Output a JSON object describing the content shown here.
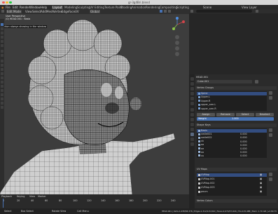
{
  "window": {
    "title": "gr-3g4Bri.blend"
  },
  "top_menu": {
    "items": [
      "File",
      "Edit",
      "Render",
      "Window",
      "Help"
    ],
    "workspaces": [
      "Layout",
      "Modeling",
      "Sculpting",
      "UV Editing",
      "Texture Paint",
      "Shading",
      "Animation",
      "Rendering",
      "Compositing",
      "Scripting"
    ],
    "active_workspace": "Layout",
    "scene": "Scene",
    "view_layer": "View Layer"
  },
  "viewport": {
    "mode": "Edit Mode",
    "menus": [
      "View",
      "Select",
      "Add",
      "Mesh",
      "Vertex",
      "Edge",
      "Face",
      "UV"
    ],
    "transform": "Global",
    "overlay_title": "User Perspective",
    "overlay_sub": "(0) HEAD.001 : Basis",
    "tooltip": "Action always showing in the window"
  },
  "timeline": {
    "playback": "Playback",
    "keying": "Keying",
    "view": "View",
    "marker": "Marker",
    "frames": [
      "0",
      "20",
      "40",
      "60",
      "80",
      "100",
      "120",
      "140",
      "160",
      "180",
      "200",
      "220",
      "240"
    ]
  },
  "statusbar": {
    "left_items": [
      "Select",
      "Box Select",
      "Rotate View",
      "Call Menu"
    ],
    "right": "HEAD.001 | Verts:1,038/58,376 | Edges:1,312/115,810 | Faces:2,074/57,616 | Tris:115,488 | Mem: 1.70 GB | v2.80.75"
  },
  "outliner": {
    "search_placeholder": "",
    "items": [
      {
        "name": "Collection",
        "selected": false
      },
      {
        "name": "Empty",
        "selected": false
      },
      {
        "name": "Empty.001",
        "selected": false
      },
      {
        "name": "Empty.002",
        "selected": false
      },
      {
        "name": "Empty.003",
        "selected": false
      },
      {
        "name": "Empty.004",
        "selected": true
      },
      {
        "name": "Empty.005",
        "selected": false
      },
      {
        "name": "Empty.006",
        "selected": false
      },
      {
        "name": "Empty.007",
        "selected": false
      },
      {
        "name": "Empty.008",
        "selected": false
      },
      {
        "name": "Empty.009",
        "selected": false
      },
      {
        "name": "HEAD.001",
        "selected": true
      },
      {
        "name": "Lights",
        "selected": false
      }
    ]
  },
  "properties": {
    "object": "HEAD.001",
    "mesh": "Cube.001",
    "vertex_groups_title": "Vertex Groups",
    "vertex_groups": [
      "Spine",
      "Upper.L",
      "Upper.R",
      "upper_arm.L",
      "upper_arm.R"
    ],
    "vg_buttons": [
      "Assign",
      "Remove",
      "Select",
      "Deselect"
    ],
    "weight_label": "Weight",
    "weight_value": "1.000",
    "shape_keys_title": "Shape Keys",
    "shape_keys": [
      {
        "name": "Basis",
        "value": ""
      },
      {
        "name": "smile001",
        "value": "0.000"
      },
      {
        "name": "smile002",
        "value": "0.000"
      },
      {
        "name": "sh",
        "value": "0.000"
      },
      {
        "name": "aa",
        "value": "0.000"
      },
      {
        "name": "ee",
        "value": "0.000"
      },
      {
        "name": "oo",
        "value": "0.000"
      },
      {
        "name": "uu",
        "value": "0.000"
      }
    ],
    "uv_maps_title": "UV Maps",
    "uv_maps": [
      "UVMap",
      "UVMap.001",
      "UVMap.002",
      "UVMap.003",
      "pours"
    ],
    "vertex_colors_title": "Vertex Colors"
  },
  "colors": {
    "accent": "#4772b3",
    "selected_row": "#334d80",
    "mesh_wire": "#000000",
    "mesh_face": "#bdbdbd"
  }
}
